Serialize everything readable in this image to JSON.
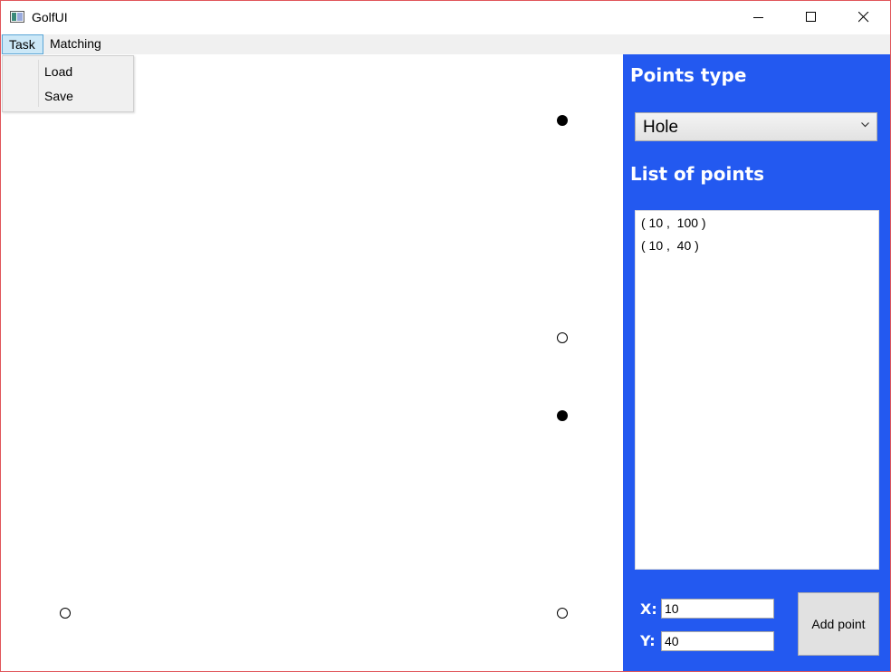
{
  "window": {
    "title": "GolfUI",
    "icon": "app-window-icon",
    "controls": [
      "minimize-icon",
      "maximize-icon",
      "close-icon"
    ]
  },
  "menu": {
    "items": [
      {
        "label": "Task",
        "active": true
      },
      {
        "label": "Matching",
        "active": false
      }
    ],
    "task_dropdown": [
      "Load",
      "Save"
    ]
  },
  "canvas": {
    "points": [
      {
        "kind": "filled"
      },
      {
        "kind": "hollow"
      },
      {
        "kind": "filled"
      },
      {
        "kind": "hollow"
      },
      {
        "kind": "hollow"
      }
    ]
  },
  "panel": {
    "background": "#2359f0",
    "points_type_heading": "Points type",
    "points_type_selected": "Hole",
    "list_heading": "List of points",
    "list_items": [
      "( 10 ,  100 )",
      "( 10 ,  40 )"
    ],
    "x_label": "X:",
    "x_value": "10",
    "y_label": "Y:",
    "y_value": "40",
    "add_button": "Add point"
  }
}
